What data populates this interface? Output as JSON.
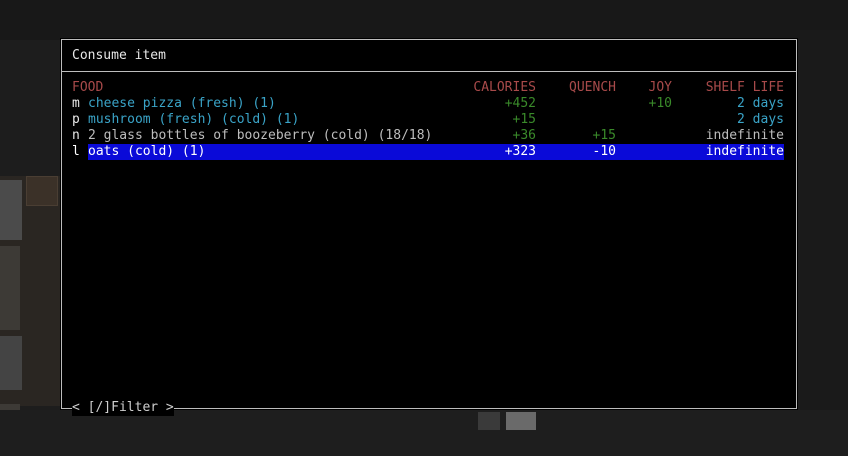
{
  "window": {
    "title": "Consume item"
  },
  "headers": {
    "food": "FOOD",
    "calories": "CALORIES",
    "quench": "QUENCH",
    "joy": "JOY",
    "shelf_life": "SHELF LIFE"
  },
  "items": [
    {
      "key": "m",
      "name": "cheese pizza (fresh) (1)",
      "calories": "+452",
      "quench": "",
      "joy": "+10",
      "shelf_life": "2 days"
    },
    {
      "key": "p",
      "name": "mushroom (fresh) (cold) (1)",
      "calories": "+15",
      "quench": "",
      "joy": "",
      "shelf_life": "2 days"
    },
    {
      "key": "n",
      "name": "2 glass bottles of boozeberry (cold) (18/18)",
      "calories": "+36",
      "quench": "+15",
      "joy": "",
      "shelf_life": "indefinite"
    },
    {
      "key": "l",
      "name": "oats (cold) (1)",
      "calories": "+323",
      "quench": "-10",
      "joy": "",
      "shelf_life": "indefinite"
    }
  ],
  "footer": {
    "filter_label": "< [/]Filter >"
  },
  "colors": {
    "header": "#a84a4a",
    "fresh_item": "#3aa4c8",
    "positive_stat": "#3a8a2a",
    "selection": "#0a0ad8"
  }
}
